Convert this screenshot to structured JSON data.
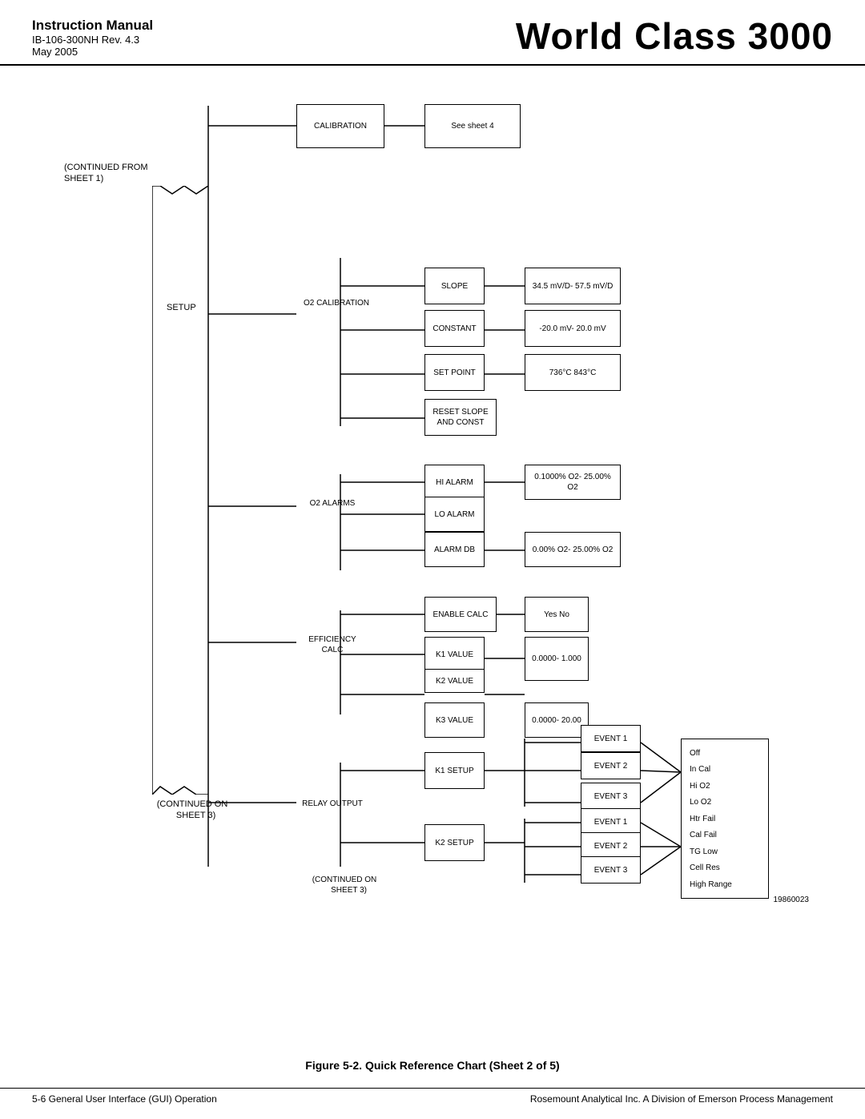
{
  "header": {
    "title": "Instruction Manual",
    "subtitle_line1": "IB-106-300NH Rev. 4.3",
    "subtitle_line2": "May 2005",
    "brand": "World Class 3000"
  },
  "footer": {
    "left": "5-6    General User Interface (GUI) Operation",
    "right": "Rosemount Analytical Inc.   A Division of Emerson Process Management"
  },
  "figure_caption": "Figure 5-2.  Quick Reference Chart (Sheet 2 of 5)",
  "doc_number": "19860023",
  "diagram": {
    "labels": {
      "continued_from": "(CONTINUED  FROM\n     SHEET 1)",
      "setup": "SETUP",
      "continued_on_bottom": "(CONTINUED ON\n    SHEET 3)",
      "calibration": "CALIBRATION",
      "o2_calibration": "O2  CALIBRATION",
      "o2_alarms": "O2  ALARMS",
      "efficiency_calc": "EFFICIENCY\nCALC",
      "relay_output": "RELAY  OUTPUT"
    },
    "boxes": {
      "see_sheet": "See  sheet  4",
      "slope": "SLOPE",
      "constant": "CONSTANT",
      "set_point": "SET  POINT",
      "reset_slope": "RESET  SLOPE\nAND  CONST",
      "hi_alarm": "HI  ALARM",
      "lo_alarm": "LO ALARM",
      "alarm_db": "ALARM DB",
      "enable_calc": "ENABLE  CALC",
      "k1_value": "K1  VALUE",
      "k2_value": "K2  VALUE",
      "k3_value": "K3  VALUE",
      "k1_setup": "K1  SETUP",
      "k2_setup": "K2  SETUP",
      "slope_val": "34.5 mV/D-\n57.5 mV/D",
      "constant_val": "-20.0 mV-\n20.0 mV",
      "set_point_val": "736°C\n843°C",
      "hi_alarm_val": "0.1000% O2-\n25.00% O2",
      "alarm_db_val": "0.00% O2-\n25.00% O2",
      "yes_no": "Yes\nNo",
      "k1k2_val": "0.0000-\n1.000",
      "k3_val": "0.0000-\n20.00",
      "event_k1_1": "EVENT 1",
      "event_k1_2": "EVENT 2",
      "event_k1_3": "EVENT 3",
      "event_k2_1": "EVENT 1",
      "event_k2_2": "EVENT 2",
      "event_k2_3": "EVENT 3",
      "options": "Off\nIn Cal\nHi O2\nLo O2\nHtr Fail\nCal Fail\nTG Low\nCell Res\nHigh Range"
    }
  }
}
